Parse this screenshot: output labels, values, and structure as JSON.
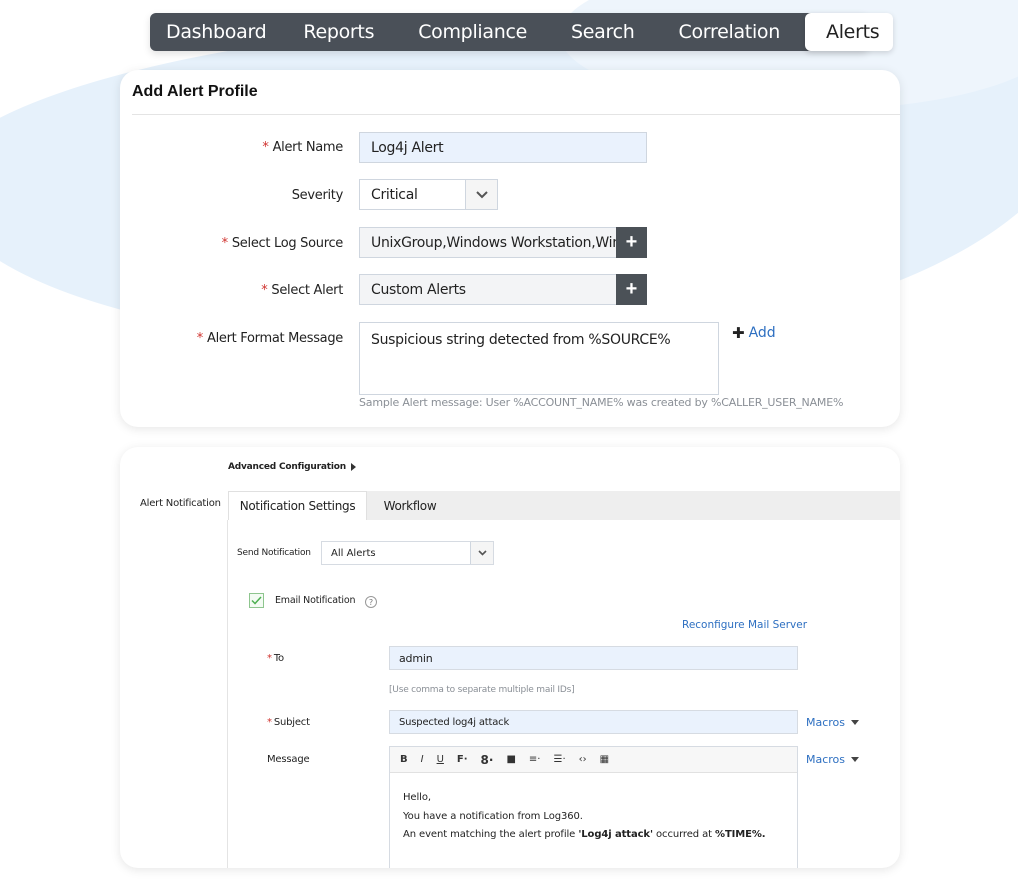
{
  "nav": {
    "items": [
      {
        "label": "Dashboard",
        "active": false
      },
      {
        "label": "Reports",
        "active": false
      },
      {
        "label": "Compliance",
        "active": false
      },
      {
        "label": "Search",
        "active": false
      },
      {
        "label": "Correlation",
        "active": false
      },
      {
        "label": "Alerts",
        "active": true
      }
    ]
  },
  "alert_profile": {
    "title": "Add Alert Profile",
    "required_mark": "*",
    "alert_name": {
      "label": "Alert Name",
      "value": "Log4j Alert"
    },
    "severity": {
      "label": "Severity",
      "value": "Critical"
    },
    "log_source": {
      "label": "Select Log Source",
      "value": "UnixGroup,Windows Workstation,Windows Server"
    },
    "select_alert": {
      "label": "Select Alert",
      "value": "Custom Alerts"
    },
    "format_message": {
      "label": "Alert Format Message",
      "value": "Suspicious string detected from %SOURCE%",
      "add_label": "Add",
      "sample": "Sample Alert message: User %ACCOUNT_NAME% was created by %CALLER_USER_NAME%"
    }
  },
  "advanced": {
    "header": "Advanced Configuration",
    "side_label": "Alert Notification",
    "tabs": [
      {
        "label": "Notification Settings",
        "active": true
      },
      {
        "label": "Workflow",
        "active": false
      }
    ],
    "send_notification": {
      "label": "Send Notification",
      "value": "All Alerts"
    },
    "email_notification": {
      "label": "Email Notification",
      "checked": true,
      "help": "?"
    },
    "reconfigure_link": "Reconfigure Mail Server",
    "to": {
      "label": "To",
      "value": "admin",
      "hint": "[Use comma to separate multiple mail IDs]"
    },
    "subject": {
      "label": "Subject",
      "value": "Suspected log4j attack",
      "macros": "Macros"
    },
    "message": {
      "label": "Message",
      "macros": "Macros",
      "toolbar": [
        "B",
        "I",
        "U",
        "F·",
        "8·",
        "■",
        "≡·",
        "☰·",
        "‹›",
        "▦"
      ],
      "body": {
        "greeting": "Hello,",
        "line1": "You have a notification from Log360.",
        "line2_prefix": "An event matching the alert profile ",
        "line2_profile": "'Log4j attack'",
        "line2_mid": " occurred at ",
        "line2_time": "%TIME%."
      }
    }
  }
}
